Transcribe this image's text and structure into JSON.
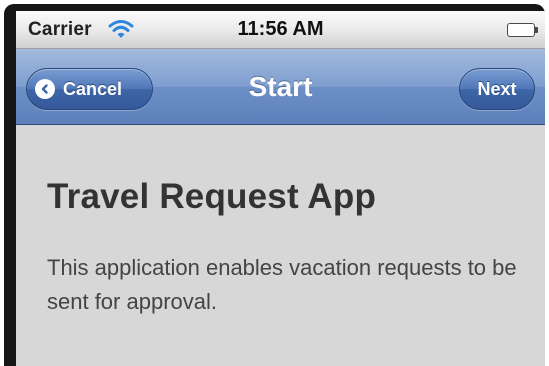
{
  "status_bar": {
    "carrier": "Carrier",
    "time": "11:56 AM",
    "icons": [
      "wifi-icon",
      "battery-icon"
    ],
    "battery_level": 1.0
  },
  "nav_bar": {
    "title": "Start",
    "cancel_label": "Cancel",
    "next_label": "Next",
    "cancel_icon": "chevron-left-icon"
  },
  "content": {
    "heading": "Travel Request App",
    "description": "This application enables vacation requests to be sent for approval."
  },
  "colors": {
    "nav_bar": "#7f9ed0",
    "nav_button": "#3e66a7",
    "content_background": "#d7d7d7",
    "heading_text": "#333333",
    "battery_fill": "#55c21a"
  }
}
